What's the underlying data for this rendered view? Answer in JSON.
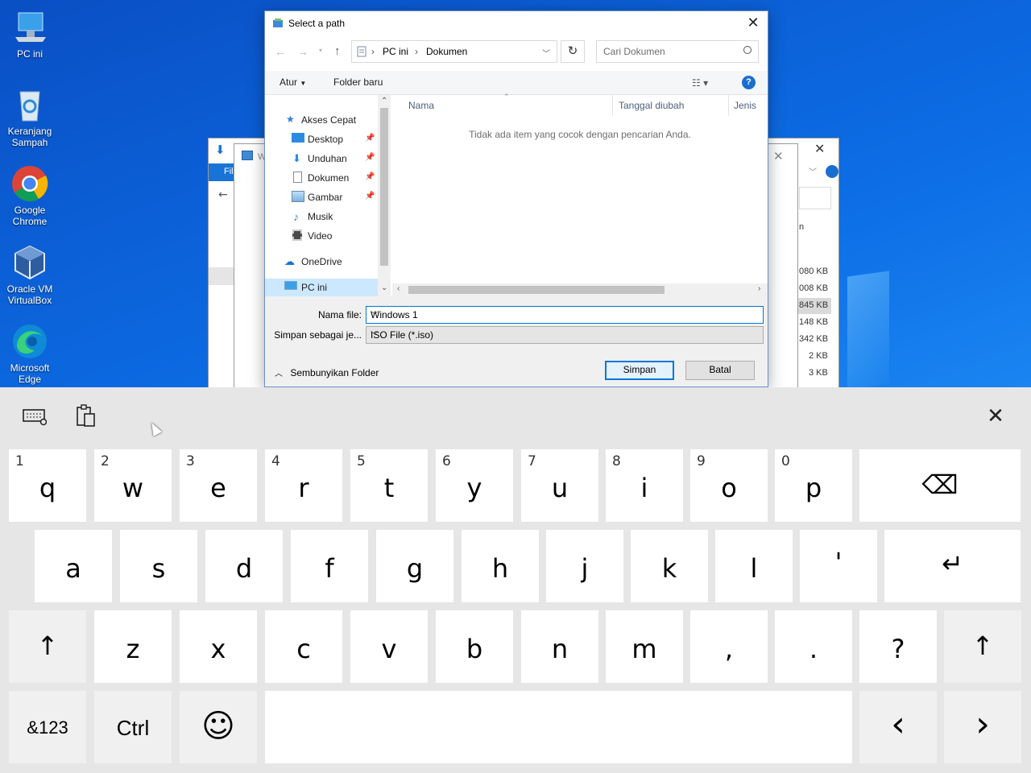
{
  "desktop": {
    "icons": [
      {
        "label": "PC ini",
        "icon": "this-pc-icon"
      },
      {
        "label": "Keranjang Sampah",
        "icon": "recycle-bin-icon"
      },
      {
        "label": "Google Chrome",
        "icon": "chrome-icon"
      },
      {
        "label": "Oracle VM VirtualBox",
        "icon": "virtualbox-icon"
      },
      {
        "label": "Microsoft Edge",
        "icon": "edge-icon"
      }
    ]
  },
  "background_windows": {
    "fragment_left_1": "Fil",
    "fragment_left_2": "W",
    "fragment_right": "n",
    "sizes": [
      "080 KB",
      "008 KB",
      "845 KB",
      "148 KB",
      "342 KB",
      "2 KB",
      "3 KB"
    ]
  },
  "dialog": {
    "title": "Select a path",
    "address": {
      "root": "PC ini",
      "folder": "Dokumen"
    },
    "search_placeholder": "Cari Dokumen",
    "toolbar": {
      "organize": "Atur",
      "new_folder": "Folder baru",
      "help": "?"
    },
    "nav": {
      "quick_access": "Akses Cepat",
      "items": [
        {
          "label": "Desktop",
          "icon": "desktop-folder-icon",
          "pinned": true
        },
        {
          "label": "Unduhan",
          "icon": "downloads-icon",
          "pinned": true
        },
        {
          "label": "Dokumen",
          "icon": "documents-icon",
          "pinned": true
        },
        {
          "label": "Gambar",
          "icon": "pictures-icon",
          "pinned": true
        },
        {
          "label": "Musik",
          "icon": "music-icon",
          "pinned": false
        },
        {
          "label": "Video",
          "icon": "video-icon",
          "pinned": false
        }
      ],
      "onedrive": "OneDrive",
      "this_pc": "PC ini"
    },
    "columns": {
      "name": "Nama",
      "date": "Tanggal diubah",
      "type": "Jenis"
    },
    "empty_message": "Tidak ada item yang cocok dengan pencarian Anda.",
    "filename_label": "Nama file:",
    "filename_value": "Windows 1",
    "savetype_label": "Simpan sebagai je...",
    "savetype_value": "ISO File (*.iso)",
    "hide_folders": "Sembunyikan Folder",
    "save_button": "Simpan",
    "cancel_button": "Batal"
  },
  "keyboard": {
    "row1": [
      {
        "key": "q",
        "num": "1"
      },
      {
        "key": "w",
        "num": "2"
      },
      {
        "key": "e",
        "num": "3"
      },
      {
        "key": "r",
        "num": "4"
      },
      {
        "key": "t",
        "num": "5"
      },
      {
        "key": "y",
        "num": "6"
      },
      {
        "key": "u",
        "num": "7"
      },
      {
        "key": "i",
        "num": "8"
      },
      {
        "key": "o",
        "num": "9"
      },
      {
        "key": "p",
        "num": "0"
      }
    ],
    "row2": [
      "a",
      "s",
      "d",
      "f",
      "g",
      "h",
      "j",
      "k",
      "l",
      "'"
    ],
    "row3": [
      "z",
      "x",
      "c",
      "v",
      "b",
      "n",
      "m",
      ",",
      ".",
      "?"
    ],
    "backspace": "⌫",
    "enter": "↵",
    "shift": "↑",
    "symbols": "&123",
    "ctrl": "Ctrl",
    "emoji": "☺",
    "left": "‹",
    "right": "›",
    "close": "✕"
  }
}
